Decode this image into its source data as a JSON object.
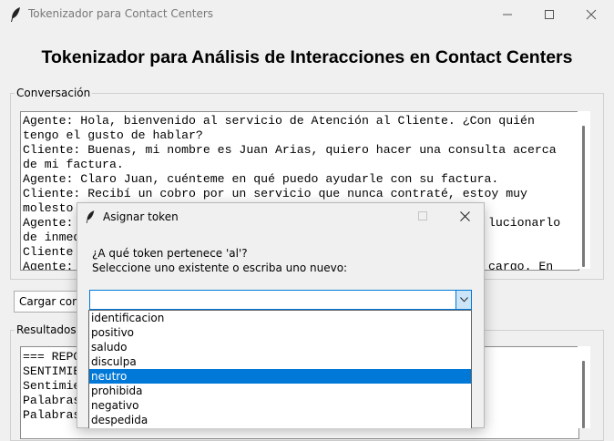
{
  "window": {
    "title": "Tokenizador para Contact Centers",
    "app_icon": "feather-icon"
  },
  "heading": "Tokenizador para Análisis de Interacciones en Contact Centers",
  "conversation": {
    "label": "Conversación",
    "lines": [
      "Agente: Hola, bienvenido al servicio de Atención al Cliente. ¿Con quién",
      "tengo el gusto de hablar?",
      "Cliente: Buenas, mi nombre es Juan Arias, quiero hacer una consulta acerca",
      "de mi factura.",
      "Agente: Claro Juan, cuénteme en qué puedo ayudarle con su factura.",
      "Cliente: Recibí un cobro por un servicio que nunca contraté, estoy muy",
      "molesto",
      "Agente:",
      "de inmed",
      "Cliente",
      "Agente:"
    ],
    "hidden_line_tails": {
      "agente_1": "lucionarlo",
      "agente_2": "cargo. En"
    }
  },
  "load_button": {
    "label": "Cargar conv"
  },
  "results": {
    "label": "Resultados",
    "lines": [
      "=== REPO",
      "",
      "SENTIMIE",
      "Sentimien",
      "Palabras s",
      "Palabras n"
    ]
  },
  "dialog": {
    "title": "Asignar token",
    "question": "¿A qué token pertenece 'al'?",
    "instruction": "Seleccione uno existente o escriba uno nuevo:",
    "combo_value": "",
    "options": [
      "identificacion",
      "positivo",
      "saludo",
      "disculpa",
      "neutro",
      "prohibida",
      "negativo",
      "despedida"
    ],
    "selected_index": 4
  },
  "colors": {
    "accent": "#0078d7",
    "background": "#f0f0f0"
  }
}
